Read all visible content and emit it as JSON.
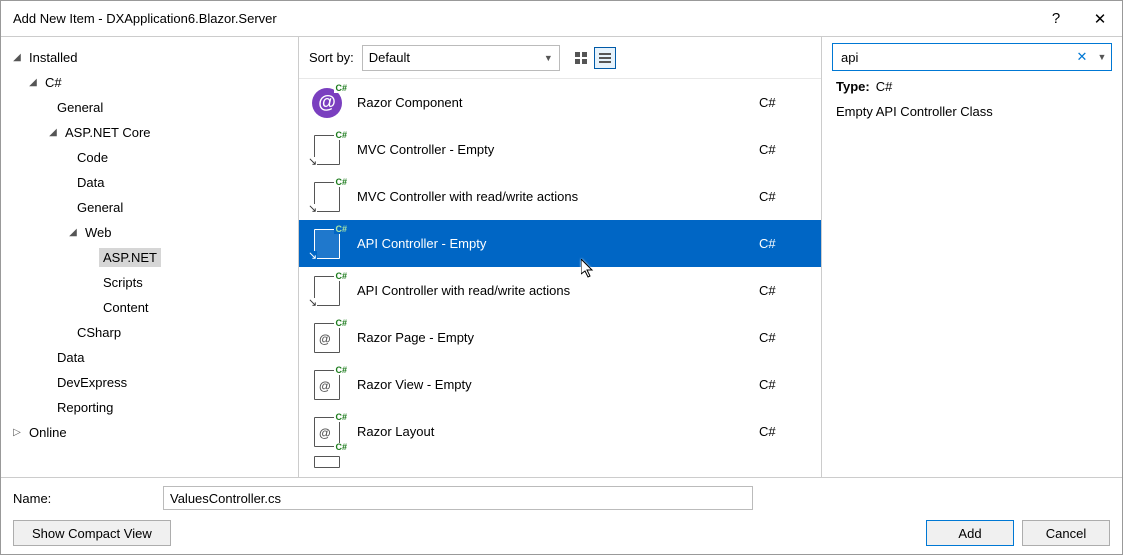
{
  "window": {
    "title": "Add New Item - DXApplication6.Blazor.Server"
  },
  "tree": {
    "installed": "Installed",
    "csharp": "C#",
    "general1": "General",
    "aspnetcore": "ASP.NET Core",
    "code": "Code",
    "data": "Data",
    "general2": "General",
    "web": "Web",
    "aspnet": "ASP.NET",
    "scripts": "Scripts",
    "content": "Content",
    "csharp2": "CSharp",
    "data2": "Data",
    "devexpress": "DevExpress",
    "reporting": "Reporting",
    "online": "Online"
  },
  "toolbar": {
    "sort_label": "Sort by:",
    "sort_value": "Default"
  },
  "templates": [
    {
      "name": "Razor Component",
      "lang": "C#",
      "icon": "razor"
    },
    {
      "name": "MVC Controller - Empty",
      "lang": "C#",
      "icon": "ctrl"
    },
    {
      "name": "MVC Controller with read/write actions",
      "lang": "C#",
      "icon": "ctrl"
    },
    {
      "name": "API Controller - Empty",
      "lang": "C#",
      "icon": "ctrl",
      "selected": true
    },
    {
      "name": "API Controller with read/write actions",
      "lang": "C#",
      "icon": "ctrl"
    },
    {
      "name": "Razor Page - Empty",
      "lang": "C#",
      "icon": "page"
    },
    {
      "name": "Razor View - Empty",
      "lang": "C#",
      "icon": "page"
    },
    {
      "name": "Razor Layout",
      "lang": "C#",
      "icon": "page"
    }
  ],
  "search": {
    "value": "api"
  },
  "details": {
    "type_label": "Type:",
    "type_value": "C#",
    "description": "Empty API Controller Class"
  },
  "footer": {
    "name_label": "Name:",
    "name_value": "ValuesController.cs",
    "compact": "Show Compact View",
    "add": "Add",
    "cancel": "Cancel"
  },
  "icons": {
    "badge": "C#"
  }
}
